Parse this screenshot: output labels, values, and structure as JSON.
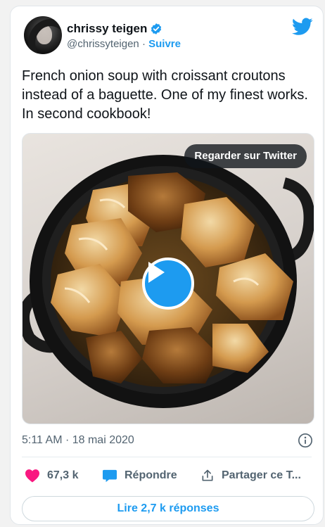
{
  "author": {
    "name": "chrissy teigen",
    "handle": "@chrissyteigen",
    "separator": " · ",
    "follow_label": "Suivre",
    "verified": true
  },
  "tweet": {
    "text": "French onion soup with croissant croutons instead of a baguette. One of my finest works. In second cookbook!"
  },
  "media": {
    "watch_label": "Regarder sur Twitter",
    "play_icon": "play-icon"
  },
  "meta": {
    "timestamp": "5:11 AM · 18 mai 2020"
  },
  "actions": {
    "likes": "67,3 k",
    "reply_label": "Répondre",
    "share_label": "Partager ce T..."
  },
  "replies_button": "Lire 2,7 k réponses",
  "colors": {
    "accent": "#1d9bf0",
    "like": "#f91880",
    "text": "#0f1419",
    "muted": "#536471"
  }
}
